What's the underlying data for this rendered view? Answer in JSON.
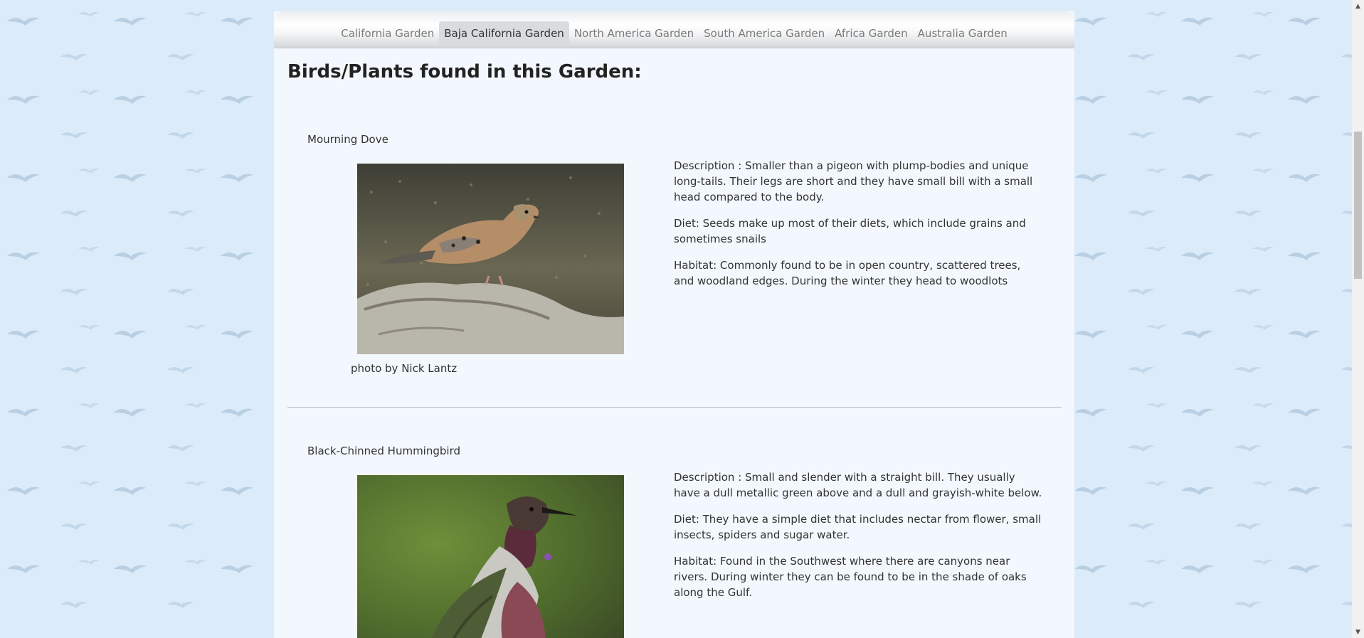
{
  "nav": {
    "items": [
      {
        "label": "California Garden",
        "active": false
      },
      {
        "label": "Baja California Garden",
        "active": true
      },
      {
        "label": "North America Garden",
        "active": false
      },
      {
        "label": "South America Garden",
        "active": false
      },
      {
        "label": "Africa Garden",
        "active": false
      },
      {
        "label": "Australia Garden",
        "active": false
      }
    ]
  },
  "main": {
    "title": "Birds/Plants found in this Garden:",
    "entries": [
      {
        "name": "Mourning Dove",
        "credit": "photo by Nick Lantz",
        "description": "Description : Smaller than a pigeon with plump-bodies and unique long-tails. Their legs are short and they have small bill with a small head compared to the body.",
        "diet": "Diet: Seeds make up most of their diets, which include grains and sometimes snails",
        "habitat": "Habitat: Commonly found to be in open country, scattered trees, and woodland edges. During the winter they head to woodlots"
      },
      {
        "name": "Black-Chinned Hummingbird",
        "description": "Description : Small and slender with a straight bill. They usually have a dull metallic green above and a dull and grayish-white below.",
        "diet": "Diet: They have a simple diet that includes nectar from flower, small insects, spiders and sugar water.",
        "habitat": "Habitat: Found in the Southwest where there are canyons near rivers. During winter they can be found to be in the shade of oaks along the Gulf."
      }
    ]
  },
  "icons": {
    "background": "flying-birds-pattern",
    "scroll_up": "arrow-up-icon",
    "scroll_down": "arrow-down-icon"
  },
  "colors": {
    "page_background": "#dcebf9",
    "content_background": "#f2f8fd",
    "active_tab": "#d9dcdf",
    "nav_text": "#7a7a7a"
  }
}
